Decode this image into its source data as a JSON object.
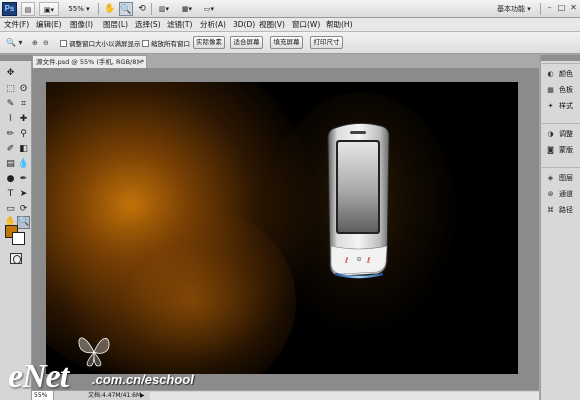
{
  "app": {
    "logo": "Ps",
    "zoom_level": "55%",
    "workspace": "基本功能",
    "window_controls": [
      "–",
      "□",
      "✕"
    ]
  },
  "menu": [
    "文件(F)",
    "编辑(E)",
    "图像(I)",
    "图层(L)",
    "选择(S)",
    "滤镜(T)",
    "分析(A)",
    "3D(D)",
    "视图(V)",
    "窗口(W)",
    "帮助(H)"
  ],
  "options": {
    "check_resize": "调整窗口大小以满屏显示",
    "check_zoom_all": "缩放所有窗口",
    "buttons": [
      "实际像素",
      "适合屏幕",
      "填充屏幕",
      "打印尺寸"
    ]
  },
  "document": {
    "tab_title": "源文件.psd @ 55% (手机, RGB/8) *",
    "close": "×"
  },
  "status": {
    "zoom": "55%",
    "doc_info": "文档:4.47M/41.6M",
    "arrow": "▶"
  },
  "colors": {
    "foreground": "#c27508",
    "background": "#ffffff"
  },
  "panels": {
    "group1": [
      {
        "label": "颜色",
        "icon": "color-icon"
      },
      {
        "label": "色板",
        "icon": "swatches-icon"
      },
      {
        "label": "样式",
        "icon": "styles-icon"
      }
    ],
    "group2": [
      {
        "label": "调整",
        "icon": "adjustments-icon"
      },
      {
        "label": "蒙版",
        "icon": "masks-icon"
      }
    ],
    "group3": [
      {
        "label": "图层",
        "icon": "layers-icon"
      },
      {
        "label": "通道",
        "icon": "channels-icon"
      },
      {
        "label": "路径",
        "icon": "paths-icon"
      }
    ]
  },
  "watermark": {
    "logo": "eNet",
    "url": ".com.cn/eschool"
  }
}
